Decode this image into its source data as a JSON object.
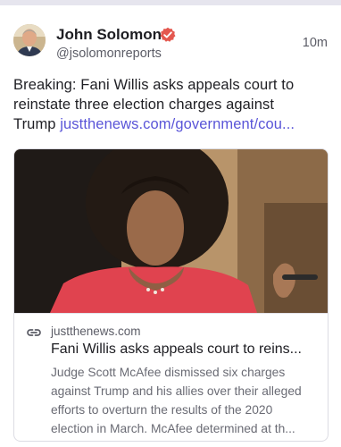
{
  "author": {
    "display_name": "John Solomon",
    "handle": "@jsolomonreports",
    "verified_icon": "verified-check-icon",
    "verified_color": "#e4584f"
  },
  "post": {
    "timestamp": "10m",
    "text_line1": "Breaking: Fani Willis asks appeals court to",
    "text_line2": "reinstate three election charges against",
    "text_line3_prefix": "Trump ",
    "link_text": "justthenews.com/government/cou...",
    "link_color": "#5a55d8"
  },
  "link_card": {
    "link_icon": "link-icon",
    "domain": "justthenews.com",
    "title": "Fani Willis asks appeals court to reins...",
    "description_lines": [
      "Judge Scott McAfee dismissed six charges",
      "against Trump and his allies over their alleged",
      "efforts to overturn the results of the 2020",
      "election in March. McAfee determined at th..."
    ]
  }
}
